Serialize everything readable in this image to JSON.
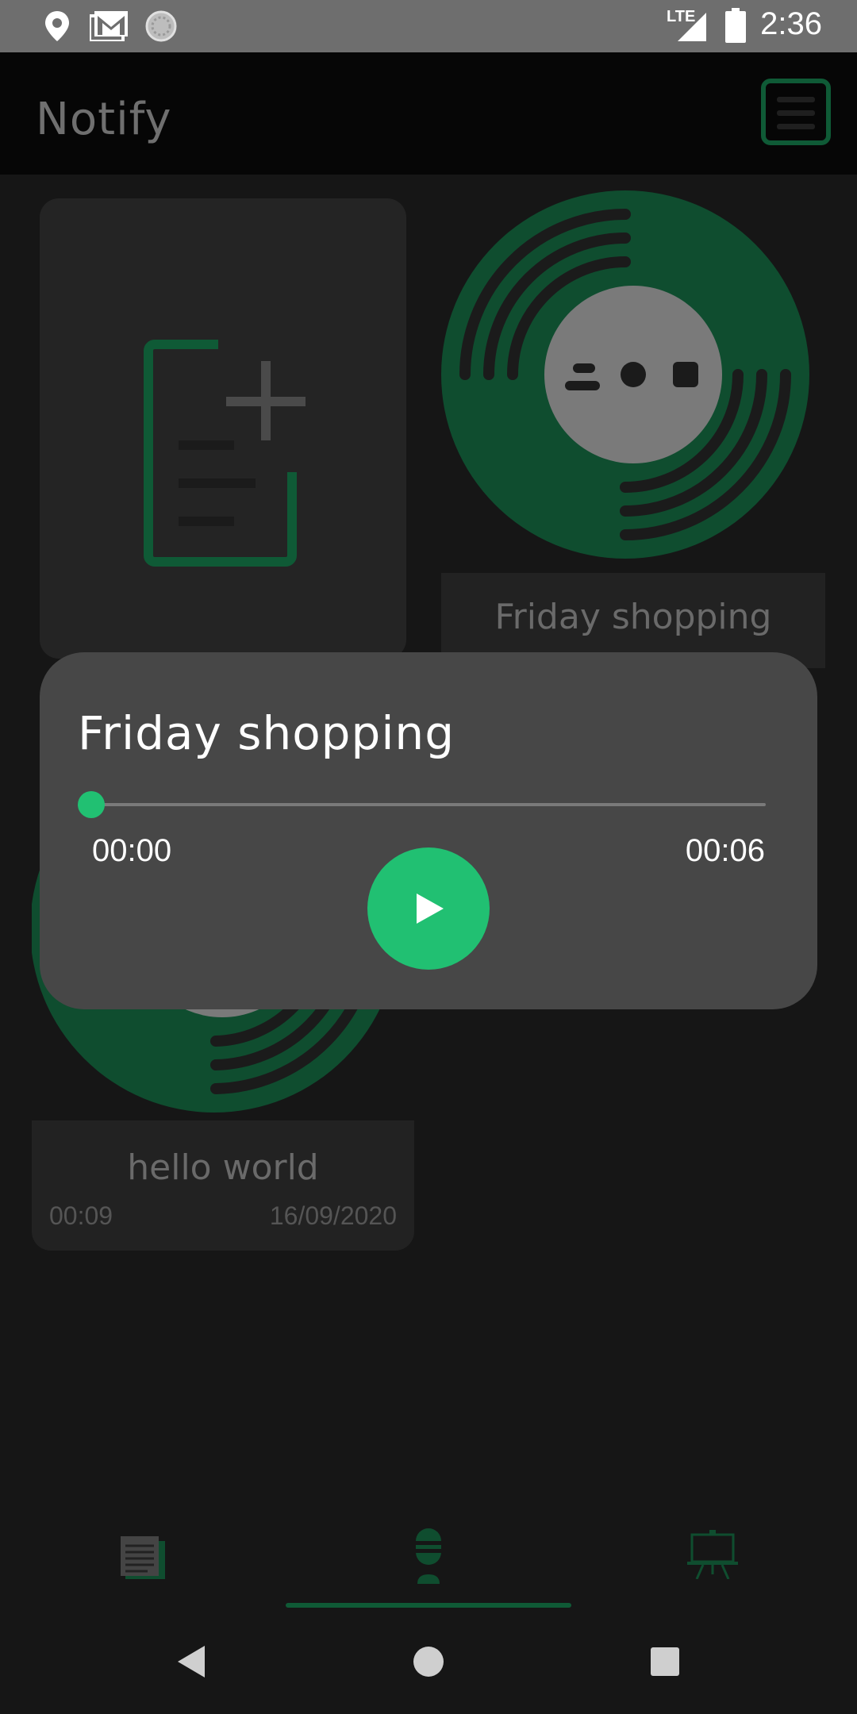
{
  "status_bar": {
    "time": "2:36",
    "network": "LTE",
    "icons": [
      "location-icon",
      "gmail-icon",
      "sync-icon",
      "lte-signal-icon",
      "battery-icon"
    ]
  },
  "app_bar": {
    "title": "Notify",
    "menu_icon": "menu-icon"
  },
  "notes": [
    {
      "title": "Friday shopping"
    },
    {
      "title": "hello world",
      "duration": "00:09",
      "date": "16/09/2020"
    }
  ],
  "player": {
    "title": "Friday shopping",
    "current_time": "00:00",
    "total_time": "00:06",
    "progress": 0.0
  },
  "bottom_nav": {
    "items": [
      "notes-icon",
      "microphone-icon",
      "whiteboard-icon"
    ],
    "active_index": 1
  },
  "colors": {
    "accent": "#21c072",
    "accent_dark": "#0f5a36",
    "background": "#161616",
    "card": "#474747"
  }
}
